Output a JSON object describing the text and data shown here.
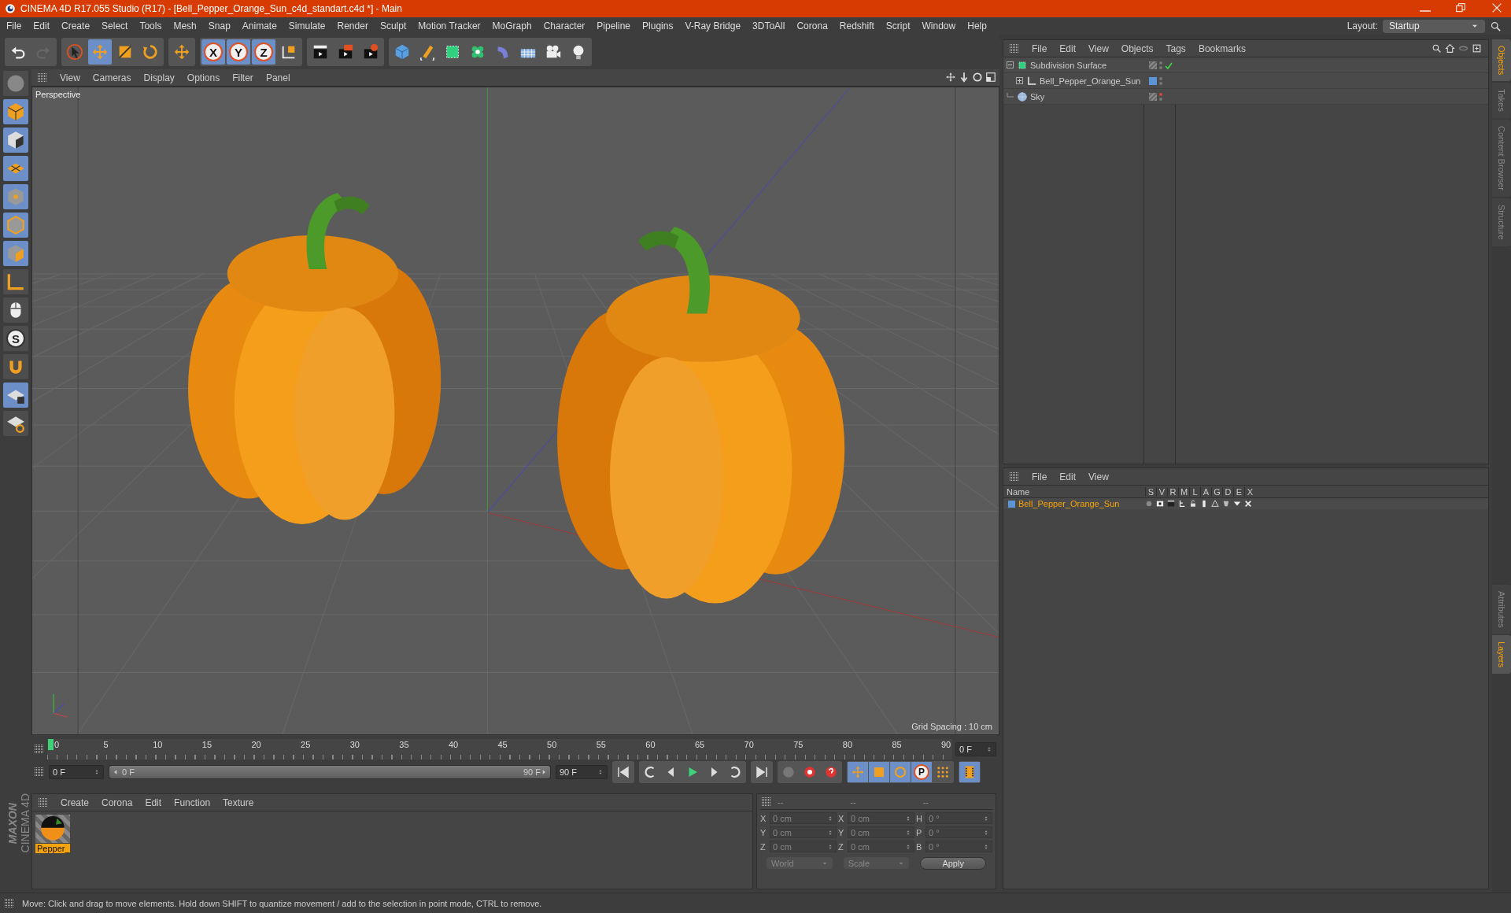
{
  "window": {
    "title": "CINEMA 4D R17.055 Studio (R17) - [Bell_Pepper_Orange_Sun_c4d_standart.c4d *] - Main"
  },
  "menu": [
    "File",
    "Edit",
    "Create",
    "Select",
    "Tools",
    "Mesh",
    "Snap",
    "Animate",
    "Simulate",
    "Render",
    "Sculpt",
    "Motion Tracker",
    "MoGraph",
    "Character",
    "Pipeline",
    "Plugins",
    "V-Ray Bridge",
    "3DToAll",
    "Corona",
    "Redshift",
    "Script",
    "Window",
    "Help"
  ],
  "layout": {
    "label": "Layout:",
    "value": "Startup"
  },
  "toolbar": {
    "axis_buttons": [
      "X",
      "Y",
      "Z"
    ]
  },
  "left_tools": {
    "snap_label": "S"
  },
  "viewport": {
    "menu": [
      "View",
      "Cameras",
      "Display",
      "Options",
      "Filter",
      "Panel"
    ],
    "camera": "Perspective",
    "grid_spacing": "Grid Spacing : 10 cm"
  },
  "objects_panel": {
    "menu": [
      "File",
      "Edit",
      "View",
      "Objects",
      "Tags",
      "Bookmarks"
    ],
    "tree": [
      {
        "name": "Subdivision Surface",
        "expanded": true,
        "checked": true,
        "render_enabled": true,
        "children": [
          {
            "name": "Bell_Pepper_Orange_Sun",
            "expanded": false,
            "checked": false,
            "render_enabled": true,
            "color": "#5b95d6"
          }
        ]
      },
      {
        "name": "Sky",
        "checked": false,
        "render_enabled": false
      }
    ]
  },
  "side_tabs_top": [
    {
      "label": "Objects",
      "selected": true
    },
    {
      "label": "Takes",
      "selected": false
    },
    {
      "label": "Content Browser",
      "selected": false
    },
    {
      "label": "Structure",
      "selected": false
    }
  ],
  "side_tabs_bottom": [
    {
      "label": "Attributes",
      "selected": false
    },
    {
      "label": "Layers",
      "selected": true
    }
  ],
  "layers_panel": {
    "menu": [
      "File",
      "Edit",
      "View"
    ],
    "columns": [
      "Name",
      "S",
      "V",
      "R",
      "M",
      "L",
      "A",
      "G",
      "D",
      "E",
      "X"
    ],
    "rows": [
      {
        "name": "Bell_Pepper_Orange_Sun",
        "color": "#5b95d6"
      }
    ]
  },
  "timeline": {
    "ruler": [
      "0",
      "5",
      "10",
      "15",
      "20",
      "25",
      "30",
      "35",
      "40",
      "45",
      "50",
      "55",
      "60",
      "65",
      "70",
      "75",
      "80",
      "85",
      "90"
    ],
    "current_frame": "0 F",
    "start": "0 F",
    "range_start": "0 F",
    "range_end": "90 F",
    "end": "90 F",
    "key_label": "P",
    "range_slider": {
      "level": 1
    }
  },
  "materials": {
    "menu": [
      "Create",
      "Corona",
      "Edit",
      "Function",
      "Texture"
    ],
    "items": [
      {
        "name": "Pepper_",
        "selected": true
      }
    ]
  },
  "coordinates": {
    "headers": [
      "--",
      "--",
      "--"
    ],
    "rows": [
      {
        "axis": "X",
        "position": "0 cm",
        "size_axis": "X",
        "size": "0 cm",
        "rot_axis": "H",
        "rotation": "0 °"
      },
      {
        "axis": "Y",
        "position": "0 cm",
        "size_axis": "Y",
        "size": "0 cm",
        "rot_axis": "P",
        "rotation": "0 °"
      },
      {
        "axis": "Z",
        "position": "0 cm",
        "size_axis": "Z",
        "size": "0 cm",
        "rot_axis": "B",
        "rotation": "0 °"
      }
    ],
    "dropdowns": [
      "World",
      "Scale"
    ],
    "apply": "Apply"
  },
  "logo": {
    "brand": "MAXON",
    "product": "CINEMA 4D"
  },
  "status": "Move: Click and drag to move elements. Hold down SHIFT to quantize movement / add to the selection in point mode, CTRL to remove."
}
